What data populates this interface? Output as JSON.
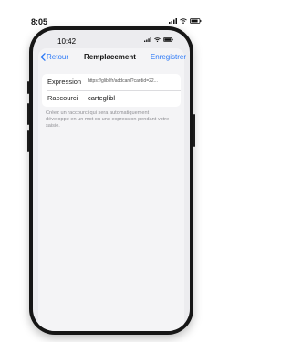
{
  "outer_status": {
    "time": "8:05"
  },
  "status": {
    "time": "10:42"
  },
  "nav": {
    "back_label": "Retour",
    "title": "Remplacement",
    "save_label": "Enregistrer"
  },
  "form": {
    "expression_label": "Expression",
    "expression_value": "https://glibl.fr/addcard?cardid=22...",
    "shortcut_label": "Raccourci",
    "shortcut_value": "carteglibl"
  },
  "help_text": "Créez un raccourci qui sera automatiquement développé en un mot ou une expression pendant votre saisie.",
  "colors": {
    "accent": "#2b78f6",
    "frame": "#161616",
    "background": "#ececef"
  }
}
